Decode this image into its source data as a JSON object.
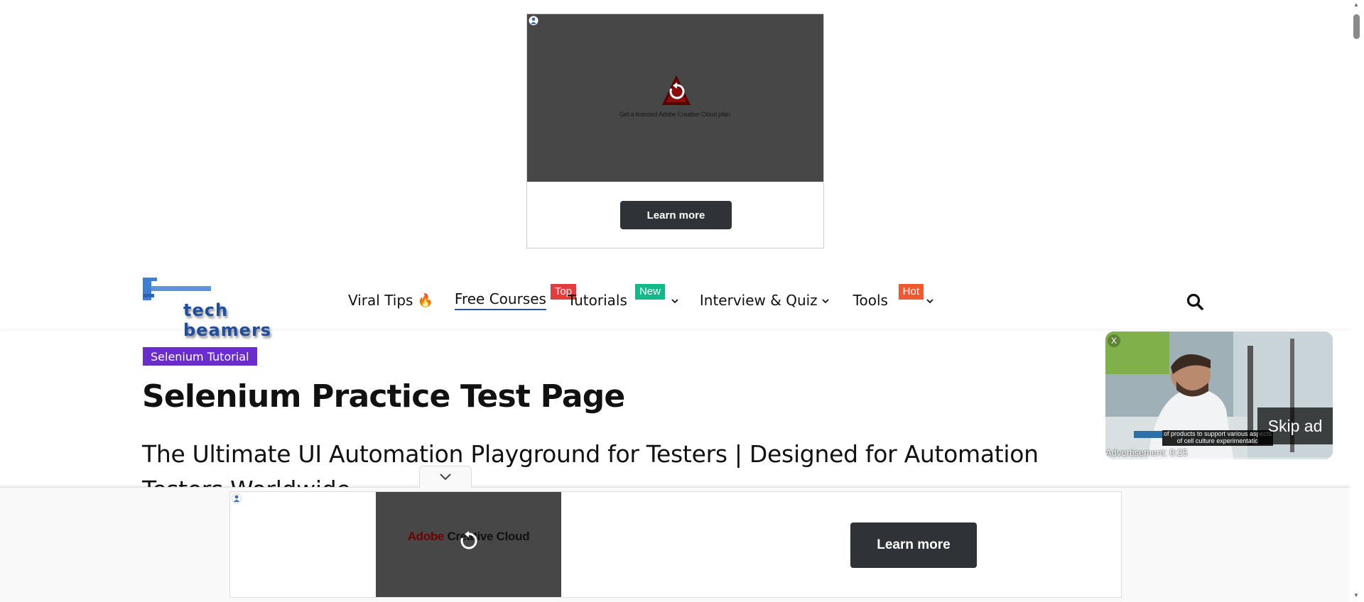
{
  "top_ad": {
    "tagline": "Get a licensed Adobe Creative Cloud plan.",
    "cta_label": "Learn more",
    "icons": [
      "adchoices-icon",
      "adobe-logo-icon",
      "replay-icon"
    ]
  },
  "header": {
    "logo_text": "tech beamers",
    "nav": [
      {
        "label": "Viral Tips",
        "icon": "🔥",
        "badge": null
      },
      {
        "label": "Free Courses",
        "badge": "Top",
        "badge_color": "#e23c3c",
        "active": true
      },
      {
        "label": "Tutorials",
        "badge": "New",
        "badge_color": "#13b98b",
        "dropdown": true
      },
      {
        "label": "Interview & Quiz",
        "dropdown": true
      },
      {
        "label": "Tools",
        "badge": "Hot",
        "badge_color": "#f0592f",
        "dropdown": true
      }
    ],
    "search_icon": "search-icon"
  },
  "article": {
    "category": "Selenium Tutorial",
    "category_color": "#6a2ccb",
    "title": "Selenium Practice Test Page",
    "subtitle": "The Ultimate UI Automation Playground for Testers | Designed for Automation Testers Worldwide"
  },
  "video_ad": {
    "close_label": "X",
    "skip_label": "Skip ad",
    "caption": "of products to support various aspects of cell culture experimentatio",
    "timer": "Advertisement: 0:25"
  },
  "bottom_ad": {
    "brand_red": "Adobe",
    "brand_black": " Creative Cloud",
    "cta_label": "Learn more"
  }
}
